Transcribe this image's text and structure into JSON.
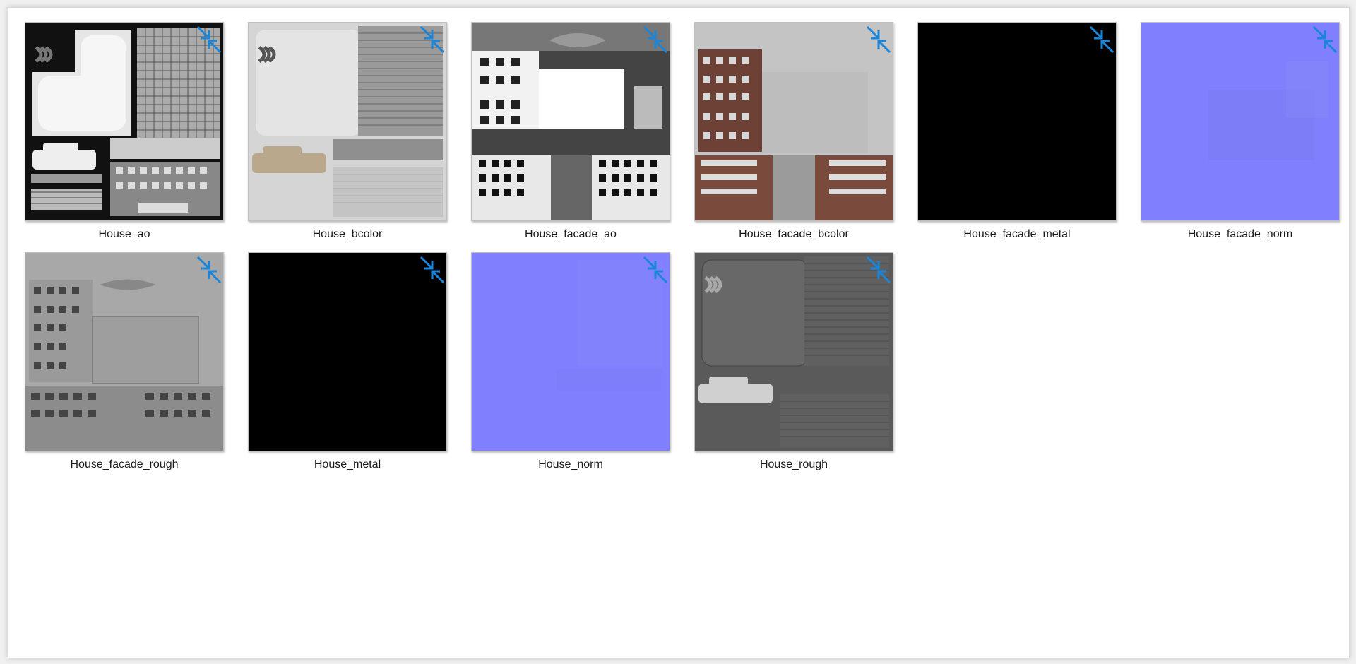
{
  "files": [
    {
      "name": "House_ao",
      "kind": "ao",
      "overlay_icon": "compress-arrows-icon"
    },
    {
      "name": "House_bcolor",
      "kind": "bcolor",
      "overlay_icon": "compress-arrows-icon"
    },
    {
      "name": "House_facade_ao",
      "kind": "facade_ao",
      "overlay_icon": "compress-arrows-icon"
    },
    {
      "name": "House_facade_bcolor",
      "kind": "facade_bcolor",
      "overlay_icon": "compress-arrows-icon"
    },
    {
      "name": "House_facade_metal",
      "kind": "metal",
      "overlay_icon": "compress-arrows-icon"
    },
    {
      "name": "House_facade_norm",
      "kind": "norm",
      "overlay_icon": "compress-arrows-icon"
    },
    {
      "name": "House_facade_rough",
      "kind": "facade_rough",
      "overlay_icon": "compress-arrows-icon"
    },
    {
      "name": "House_metal",
      "kind": "metal",
      "overlay_icon": "compress-arrows-icon"
    },
    {
      "name": "House_norm",
      "kind": "norm",
      "overlay_icon": "compress-arrows-icon"
    },
    {
      "name": "House_rough",
      "kind": "rough",
      "overlay_icon": "compress-arrows-icon"
    }
  ],
  "colors": {
    "overlay_arrow": "#1a86d9",
    "normal_map": "#8080ff",
    "metal": "#000000",
    "brick": "#7a4a3c"
  }
}
